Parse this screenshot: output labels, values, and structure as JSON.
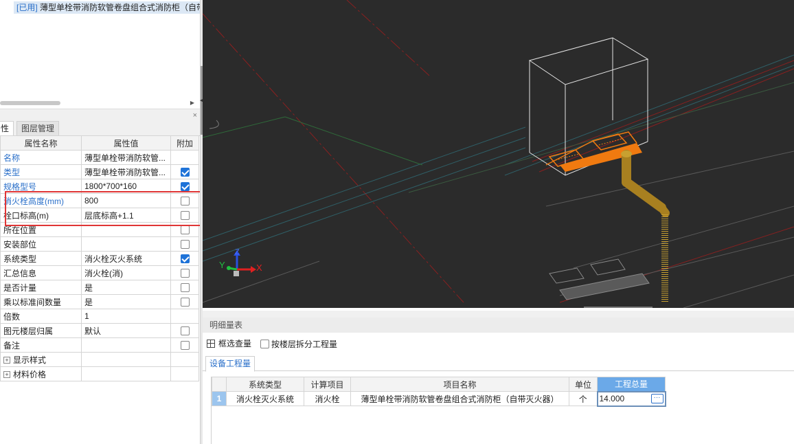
{
  "component_list": {
    "tag": "[已用]",
    "item": "薄型单栓带消防软管卷盘组合式消防柜（自带灭火器）"
  },
  "property_panel": {
    "tabs": [
      "性",
      "图层管理"
    ],
    "close_glyph": "×",
    "headers": [
      "属性名称",
      "属性值",
      "附加"
    ],
    "rows": [
      {
        "name": "名称",
        "value": "薄型单栓带消防软管...",
        "blue": true,
        "check": null
      },
      {
        "name": "类型",
        "value": "薄型单栓带消防软管...",
        "blue": true,
        "check": true
      },
      {
        "name": "规格型号",
        "value": "1800*700*160",
        "blue": true,
        "check": true
      },
      {
        "name": "消火栓高度(mm)",
        "value": "800",
        "blue": true,
        "check": false
      },
      {
        "name": "栓口标高(m)",
        "value": "层底标高+1.1",
        "blue": false,
        "check": false
      },
      {
        "name": "所在位置",
        "value": "",
        "blue": false,
        "check": false
      },
      {
        "name": "安装部位",
        "value": "",
        "blue": false,
        "check": false
      },
      {
        "name": "系统类型",
        "value": "消火栓灭火系统",
        "blue": false,
        "check": true
      },
      {
        "name": "汇总信息",
        "value": "消火栓(消)",
        "blue": false,
        "check": false
      },
      {
        "name": "是否计量",
        "value": "是",
        "blue": false,
        "check": false
      },
      {
        "name": "乘以标准间数量",
        "value": "是",
        "blue": false,
        "check": false
      },
      {
        "name": "倍数",
        "value": "1",
        "blue": false,
        "check": null
      },
      {
        "name": "图元楼层归属",
        "value": "默认",
        "blue": false,
        "check": false
      },
      {
        "name": "备注",
        "value": "",
        "blue": false,
        "check": false
      }
    ],
    "groups": [
      "显示样式",
      "材料价格"
    ],
    "expand_glyph": "+"
  },
  "viewport": {
    "axes": {
      "x": "X",
      "y": "Y",
      "z": "Z"
    },
    "colors": {
      "background": "#2b2b2b",
      "pipe": "#c8a030",
      "cabinet": "#f07a10",
      "wire": "#e6e6e6"
    }
  },
  "detail_panel": {
    "title": "明细量表",
    "select_button": "框选查量",
    "split_by_floor": "按楼层拆分工程量",
    "subtab": "设备工程量",
    "columns": [
      "系统类型",
      "计算项目",
      "项目名称",
      "单位",
      "工程总量"
    ],
    "rows": [
      {
        "index": "1",
        "system": "消火栓灭火系统",
        "item": "消火栓",
        "name": "薄型单栓带消防软管卷盘组合式消防柜（自带灭火器）",
        "unit": "个",
        "total": "14.000"
      }
    ],
    "more_glyph": "···"
  }
}
